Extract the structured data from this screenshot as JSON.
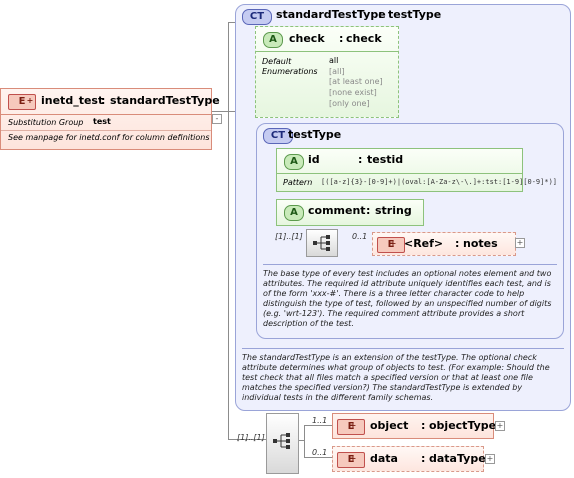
{
  "root": {
    "badge": "E",
    "name": "inetd_test",
    "sep": ":",
    "type": "standardTestType",
    "subst_label": "Substitution Group",
    "subst_value": "test",
    "note": "See manpage for inetd.conf for column definitions"
  },
  "standard_ct": {
    "badge": "CT",
    "name": "standardTestType",
    "sep": ":",
    "base": "testType",
    "description": "The standardTestType is an extension of the testType.  The optional check attribute determines what group of objects to test.  (For example: Should the test check that all files match a specified version or that at least one file matches the specified version?)  The standardTestType is extended by individual tests in the different family schemas."
  },
  "check_attr": {
    "badge": "A",
    "name": "check",
    "sep": ":",
    "type": "check",
    "default_label": "Default",
    "default_value": "all",
    "enum_label": "Enumerations",
    "enums": [
      "[all]",
      "[at least one]",
      "[none exist]",
      "[only one]"
    ]
  },
  "test_ct": {
    "badge": "CT",
    "name": "testType",
    "description": "The base type of every test includes an optional notes element and two attributes.  The required id attribute uniquely identifies each test, and is of the form 'xxx-#'.  There is a three letter character code to help distinguish the type of test, followed by an unspecified number of digits (e.g. 'wrt-123').  The required comment attribute provides a short description of the test."
  },
  "id_attr": {
    "badge": "A",
    "name": "id",
    "sep": ":",
    "type": "testid",
    "pattern_label": "Pattern",
    "pattern": "[([a-z]{3}-[0-9]+)|(oval:[A-Za-z\\-\\.]+:tst:[1-9][0-9]*)]"
  },
  "comment_attr": {
    "badge": "A",
    "name": "comment",
    "sep": ":",
    "type": "string"
  },
  "test_seq": {
    "card": "[1]..[1]"
  },
  "ref_elem": {
    "card": "0..1",
    "badge": "E",
    "name": "<Ref>",
    "sep": ":",
    "type": "notes"
  },
  "outer_seq": {
    "card": "[1]..[1]"
  },
  "object_elem": {
    "card": "1..1",
    "badge": "E",
    "name": "object",
    "sep": ":",
    "type": "objectType"
  },
  "data_elem": {
    "card": "0..1",
    "badge": "E",
    "name": "data",
    "sep": ":",
    "type": "dataType"
  }
}
